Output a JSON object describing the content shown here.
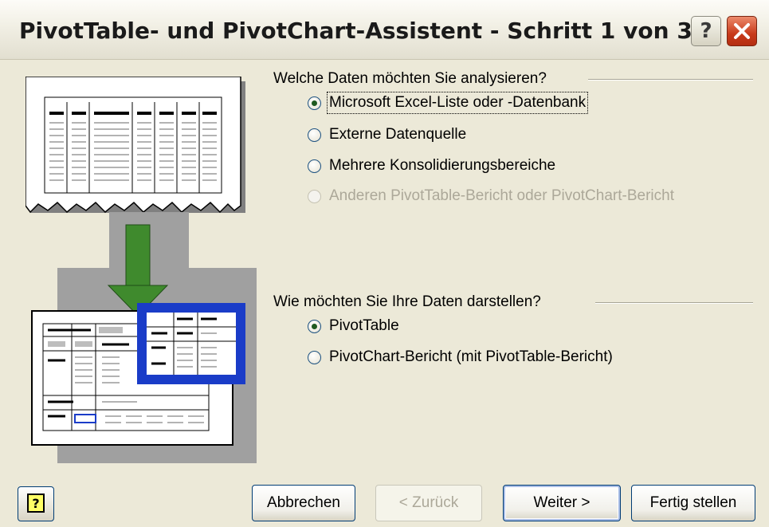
{
  "window": {
    "title": "PivotTable- und PivotChart-Assistent - Schritt 1 von 3",
    "help_glyph": "?",
    "close_icon": "close-icon"
  },
  "data_source": {
    "label": "Welche Daten möchten Sie analysieren?",
    "options": [
      {
        "label": "Microsoft Excel-Liste oder -Datenbank",
        "checked": true,
        "disabled": false
      },
      {
        "label": "Externe Datenquelle",
        "checked": false,
        "disabled": false
      },
      {
        "label": "Mehrere Konsolidierungsbereiche",
        "checked": false,
        "disabled": false
      },
      {
        "label": "Anderen PivotTable-Bericht oder PivotChart-Bericht",
        "checked": false,
        "disabled": true
      }
    ]
  },
  "report_type": {
    "label": "Wie möchten Sie Ihre Daten darstellen?",
    "options": [
      {
        "label": "PivotTable",
        "checked": true,
        "disabled": false
      },
      {
        "label": "PivotChart-Bericht (mit PivotTable-Bericht)",
        "checked": false,
        "disabled": false
      }
    ]
  },
  "buttons": {
    "help_glyph": "?",
    "cancel": "Abbrechen",
    "back": "< Zurück",
    "next": "Weiter >",
    "finish": "Fertig stellen"
  },
  "colors": {
    "dialog_bg": "#ece9d8",
    "arrow_green": "#3f8a2d",
    "highlight_blue": "#1a3cc8"
  }
}
